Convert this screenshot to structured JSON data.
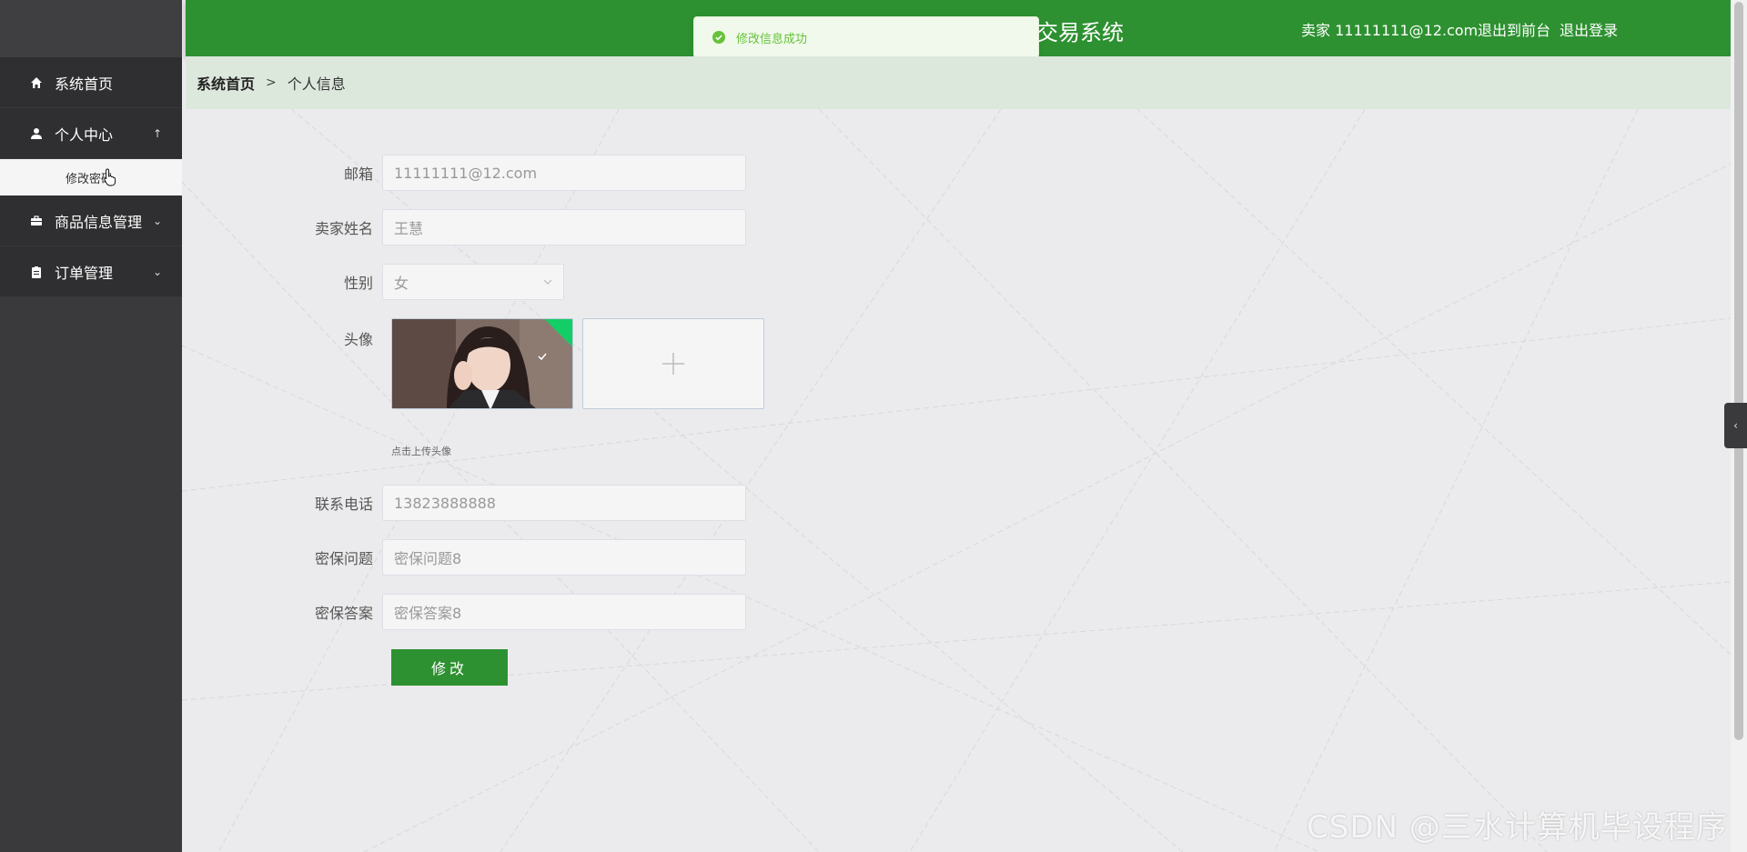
{
  "sidebar": {
    "items": [
      {
        "label": "系统首页",
        "icon": "home-icon"
      },
      {
        "label": "个人中心",
        "icon": "user-icon",
        "arrow": "↑"
      },
      {
        "label": "商品信息管理",
        "icon": "briefcase-icon",
        "arrow": "⌄"
      },
      {
        "label": "订单管理",
        "icon": "clipboard-icon",
        "arrow": "⌄"
      }
    ],
    "submenu": {
      "label": "修改密码"
    }
  },
  "header": {
    "title": "交易系统",
    "user": "卖家 11111111@12.com",
    "back_front": "退出到前台",
    "logout": "退出登录"
  },
  "toast": {
    "message": "修改信息成功",
    "color": "#67c23a"
  },
  "breadcrumb": {
    "home": "系统首页",
    "separator": ">",
    "current": "个人信息"
  },
  "form": {
    "email_label": "邮箱",
    "email_value": "11111111@12.com",
    "name_label": "卖家姓名",
    "name_value": "王慧",
    "gender_label": "性别",
    "gender_value": "女",
    "avatar_label": "头像",
    "avatar_hint": "点击上传头像",
    "phone_label": "联系电话",
    "phone_value": "13823888888",
    "question_label": "密保问题",
    "question_value": "密保问题8",
    "answer_label": "密保答案",
    "answer_value": "密保答案8",
    "submit_label": "修改"
  },
  "watermark": "CSDN @三水计算机毕设程序",
  "colors": {
    "primary": "#2e9131",
    "sidebar": "#3a3a3c",
    "success": "#13ce66"
  }
}
